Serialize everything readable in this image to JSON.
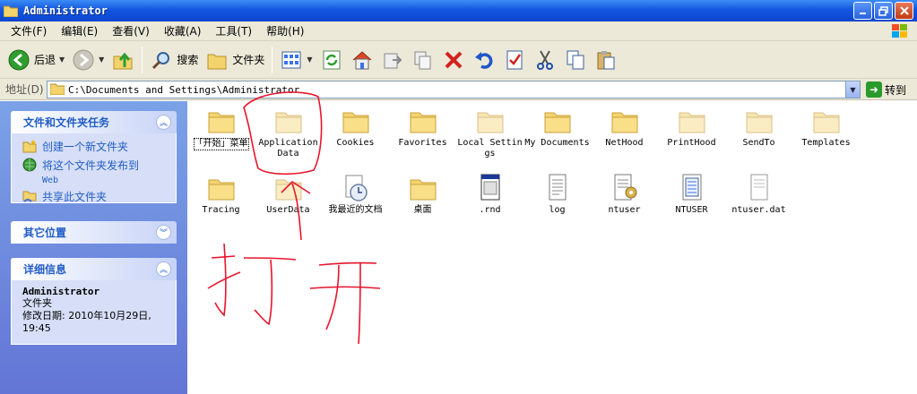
{
  "window": {
    "title": "Administrator"
  },
  "menu": [
    "文件(F)",
    "编辑(E)",
    "查看(V)",
    "收藏(A)",
    "工具(T)",
    "帮助(H)"
  ],
  "toolbar": {
    "back": "后退",
    "search": "搜索",
    "folders": "文件夹"
  },
  "address": {
    "label": "地址(D)",
    "path": "C:\\Documents and Settings\\Administrator",
    "go": "转到"
  },
  "panels": {
    "tasks": {
      "title": "文件和文件夹任务",
      "items": [
        "创建一个新文件夹",
        "将这个文件夹发布到",
        "Web",
        "共享此文件夹"
      ]
    },
    "other": {
      "title": "其它位置"
    },
    "details": {
      "title": "详细信息",
      "name": "Administrator",
      "type": "文件夹",
      "modified": "修改日期: 2010年10月29日,",
      "time": "19:45"
    }
  },
  "files": [
    {
      "label": "「开始」菜单",
      "kind": "folder"
    },
    {
      "label": "Application Data",
      "kind": "folder-faded"
    },
    {
      "label": "Cookies",
      "kind": "folder"
    },
    {
      "label": "Favorites",
      "kind": "folder"
    },
    {
      "label": "Local Settings",
      "kind": "folder-faded"
    },
    {
      "label": "My Documents",
      "kind": "folder"
    },
    {
      "label": "NetHood",
      "kind": "folder"
    },
    {
      "label": "PrintHood",
      "kind": "folder-faded"
    },
    {
      "label": "SendTo",
      "kind": "folder-faded"
    },
    {
      "label": "Templates",
      "kind": "folder-faded"
    },
    {
      "label": "Tracing",
      "kind": "folder"
    },
    {
      "label": "UserData",
      "kind": "folder-faded"
    },
    {
      "label": "我最近的文档",
      "kind": "recent"
    },
    {
      "label": "桌面",
      "kind": "folder"
    },
    {
      "label": ".rnd",
      "kind": "file-rnd"
    },
    {
      "label": "log",
      "kind": "file-doc"
    },
    {
      "label": "ntuser",
      "kind": "file-ini"
    },
    {
      "label": "NTUSER",
      "kind": "file-log"
    },
    {
      "label": "ntuser.dat",
      "kind": "file-dat"
    }
  ],
  "annotation": {
    "text": "打开",
    "color": "#e8142c"
  },
  "colors": {
    "titlebar": "#1457e0",
    "leftpane": "#6d8ede",
    "link": "#215dc6"
  }
}
